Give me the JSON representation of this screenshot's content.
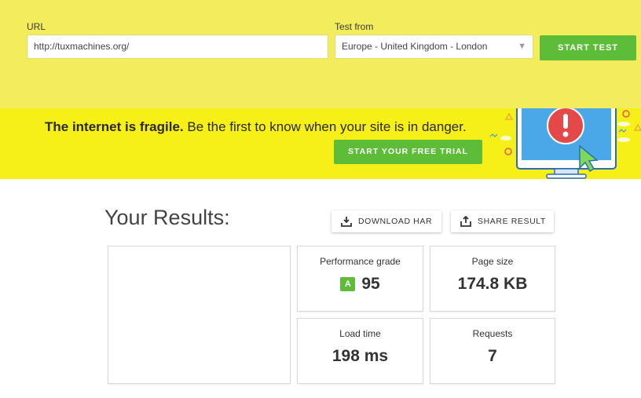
{
  "form": {
    "url_label": "URL",
    "url_value": "http://tuxmachines.org/",
    "test_from_label": "Test from",
    "test_from_value": "Europe - United Kingdom - London",
    "start_button": "START TEST"
  },
  "banner": {
    "headline_bold": "The internet is fragile.",
    "headline_rest": " Be the first to know when your site is in danger.",
    "trial_button": "START YOUR FREE TRIAL"
  },
  "results": {
    "title": "Your Results:",
    "download_button": "DOWNLOAD HAR",
    "share_button": "SHARE RESULT",
    "metrics": {
      "grade": {
        "label": "Performance grade",
        "letter": "A",
        "value": "95"
      },
      "size": {
        "label": "Page size",
        "value": "174.8 KB"
      },
      "load": {
        "label": "Load time",
        "value": "198 ms"
      },
      "requests": {
        "label": "Requests",
        "value": "7"
      }
    }
  },
  "colors": {
    "top_bg": "#f3ec5d",
    "banner_bg": "#f7ef18",
    "accent_green": "#5ebd38"
  },
  "icons": [
    "chevron-down-icon",
    "download-icon",
    "share-icon",
    "alert-monitor-illustration"
  ]
}
